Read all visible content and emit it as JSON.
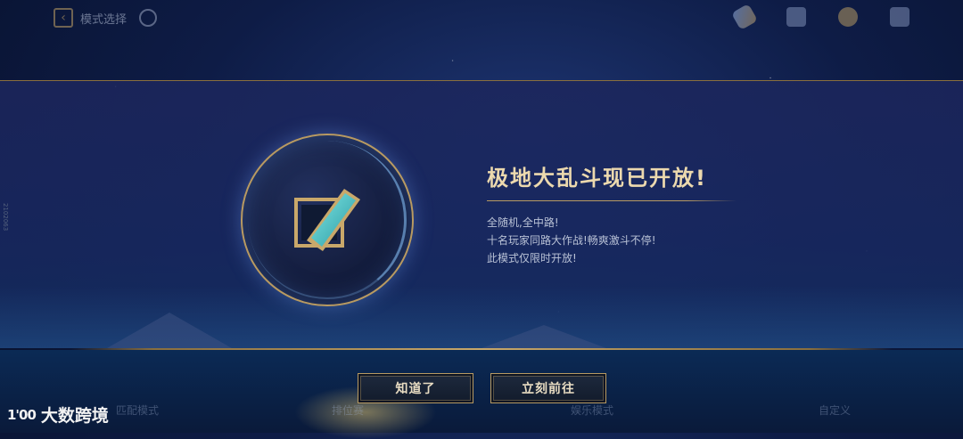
{
  "topbar": {
    "back_label": "模式选择",
    "icons": [
      "back-chevron-icon",
      "help-icon",
      "rocket-icon",
      "shop-icon",
      "coin-icon",
      "sound-icon"
    ]
  },
  "announcement": {
    "title": "极地大乱斗现已开放!",
    "lines": [
      "全随机,全中路!",
      "十名玩家同路大作战!畅爽激斗不停!",
      "此模式仅限时开放!"
    ],
    "emblem": "aram-mode-emblem-icon",
    "side_note": "2102063"
  },
  "buttons": {
    "ok_label": "知道了",
    "go_label": "立刻前往"
  },
  "bottom_tabs": [
    "匹配模式",
    "排位赛",
    "娱乐模式",
    "自定义"
  ],
  "watermark": {
    "logo": "1'00",
    "text": "大数跨境"
  },
  "colors": {
    "gold": "#b89a62",
    "title": "#ecd9ae",
    "background": "#0e1c46"
  }
}
